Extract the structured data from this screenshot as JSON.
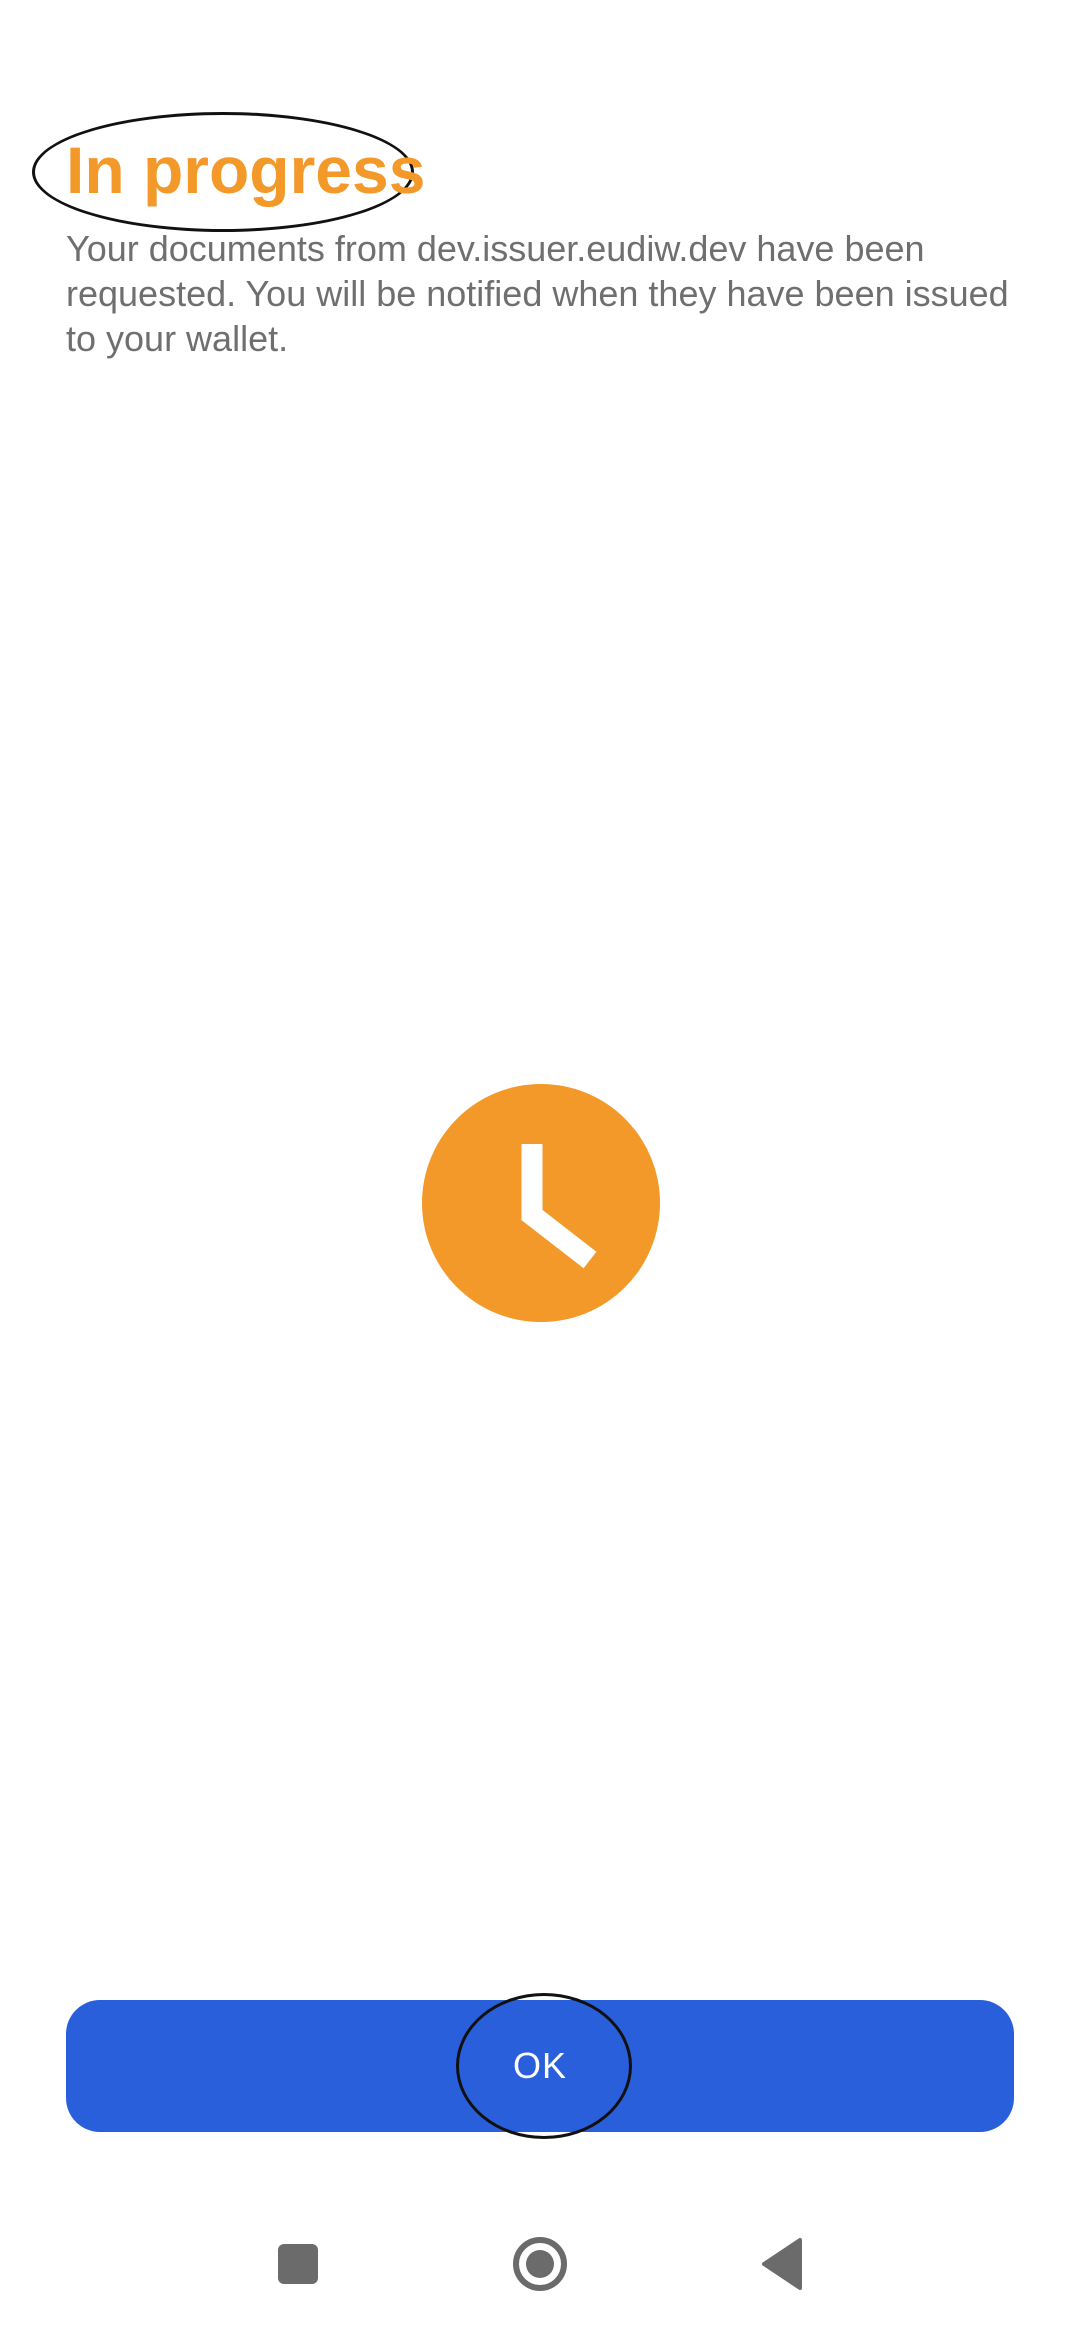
{
  "status": {
    "title": "In progress",
    "description": "Your documents from dev.issuer.eudiw.dev have been requested. You will be notified when they have been issued to your wallet.",
    "icon": "clock-icon"
  },
  "actions": {
    "ok_label": "OK"
  },
  "navigation": {
    "recents_icon": "square-icon",
    "home_icon": "circle-icon",
    "back_icon": "triangle-back-icon"
  },
  "colors": {
    "accent_orange": "#f2992a",
    "button_blue": "#2a5fdb",
    "body_text": "#6f6f6f",
    "nav_icon": "#6b6b6b"
  }
}
